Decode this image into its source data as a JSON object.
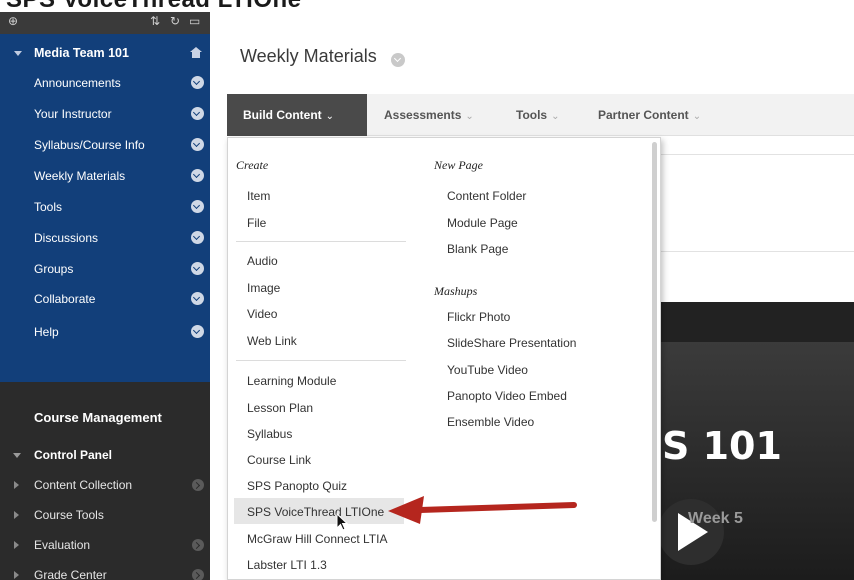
{
  "caption": {
    "text": "SPS VoiceThread LTIOne"
  },
  "sidebar": {
    "course": "Media Team 101",
    "items": [
      {
        "label": "Announcements"
      },
      {
        "label": "Your Instructor"
      },
      {
        "label": "Syllabus/Course Info"
      },
      {
        "label": "Weekly Materials"
      },
      {
        "label": "Tools"
      },
      {
        "label": "Discussions"
      },
      {
        "label": "Groups"
      },
      {
        "label": "Collaborate"
      },
      {
        "label": "Help"
      }
    ],
    "management_title": "Course Management",
    "control_panel": "Control Panel",
    "cp_items": [
      {
        "label": "Content Collection"
      },
      {
        "label": "Course Tools"
      },
      {
        "label": "Evaluation"
      },
      {
        "label": "Grade Center"
      }
    ]
  },
  "page": {
    "title": "Weekly Materials"
  },
  "actionbar": {
    "build": "Build Content",
    "assessments": "Assessments",
    "tools": "Tools",
    "partner": "Partner Content"
  },
  "menu": {
    "create_head": "Create",
    "create_items": [
      "Item",
      "File"
    ],
    "media_items": [
      "Audio",
      "Image",
      "Video",
      "Web Link"
    ],
    "learning_items": [
      "Learning Module",
      "Lesson Plan",
      "Syllabus",
      "Course Link",
      "SPS Panopto Quiz",
      "SPS VoiceThread LTIOne",
      "McGraw Hill Connect LTIA",
      "Labster LTI 1.3"
    ],
    "newpage_head": "New Page",
    "newpage_items": [
      "Content Folder",
      "Module Page",
      "Blank Page"
    ],
    "mashups_head": "Mashups",
    "mashups_items": [
      "Flickr Photo",
      "SlideShare Presentation",
      "YouTube Video",
      "Panopto Video Embed",
      "Ensemble Video"
    ]
  },
  "video": {
    "title_fragment": "S 101",
    "week": "Week 5"
  },
  "colors": {
    "sidebar_blue": "#123f7a",
    "sidebar_dark": "#2b2b2b",
    "arrow_red": "#b5261e",
    "active_tab": "#4a4a4a"
  }
}
